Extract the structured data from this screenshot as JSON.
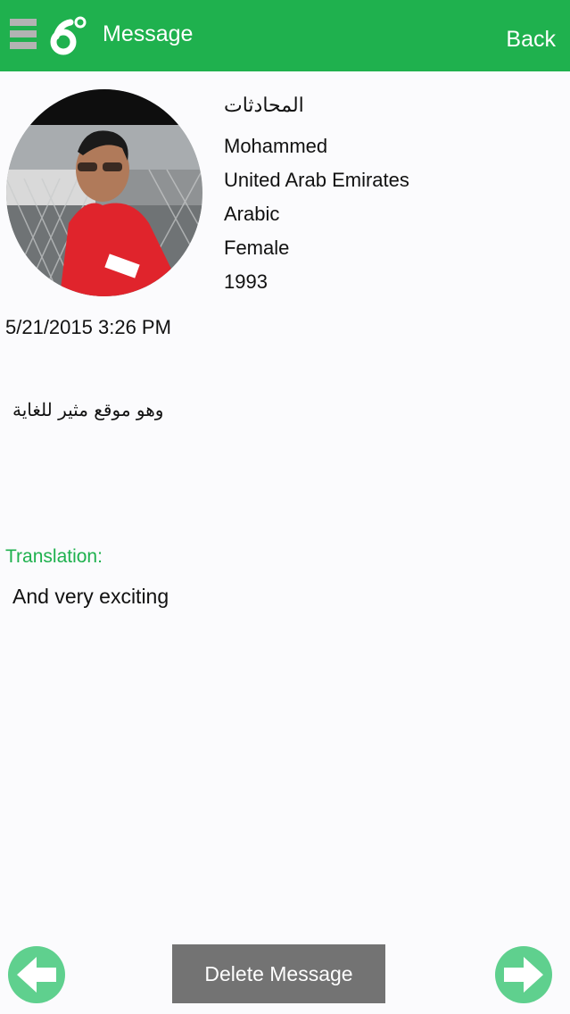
{
  "header": {
    "title": "Message",
    "back_label": "Back",
    "accent_color": "#1fb14e",
    "menu_icon": "hamburger-icon",
    "logo_icon": "app-logo-icon"
  },
  "profile": {
    "avatar_icon": "profile-photo",
    "name_arabic": "المحادثات",
    "name": "Mohammed",
    "country": "United Arab Emirates",
    "language": "Arabic",
    "gender": "Female",
    "birth_year": "1993"
  },
  "message": {
    "timestamp": "5/21/2015 3:26 PM",
    "text": "وهو موقع مثير للغاية",
    "translation_label": "Translation:",
    "translation": "And very exciting"
  },
  "footer": {
    "delete_label": "Delete Message",
    "prev_icon": "arrow-left-icon",
    "next_icon": "arrow-right-icon"
  }
}
